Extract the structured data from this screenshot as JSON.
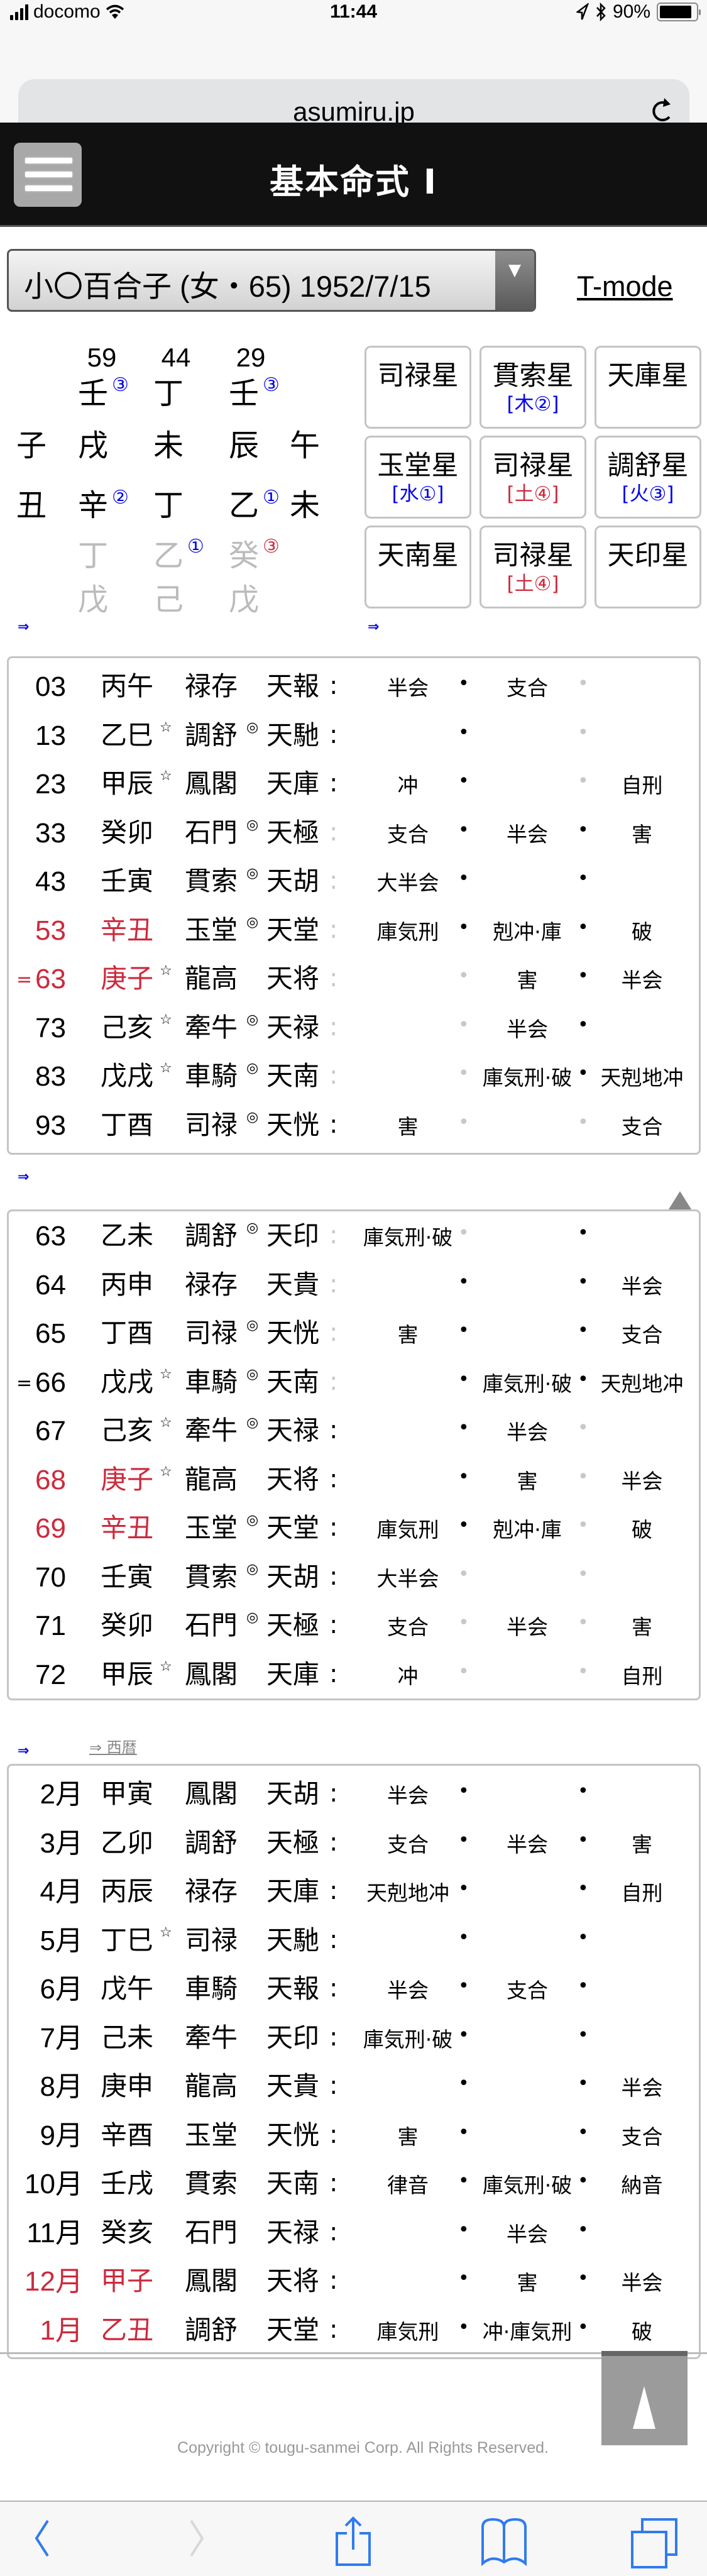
{
  "statusbar": {
    "carrier": "docomo",
    "time": "11:44",
    "battery": "90%",
    "battery_level": 0.9
  },
  "browser": {
    "url": "asumiru.jp"
  },
  "header": {
    "title": "基本命式 Ⅰ"
  },
  "selector": {
    "value": "小〇百合子 (女・65) 1952/7/15",
    "arrow": "▼"
  },
  "tmode_link": "T-mode",
  "meishiki": {
    "ages": [
      "59",
      "44",
      "29"
    ],
    "heavenly_stems": [
      "壬",
      "丁",
      "壬"
    ],
    "stem_marks": [
      "③",
      "",
      "③"
    ],
    "earthly_branches": [
      "戌",
      "未",
      "辰"
    ],
    "side_branches_top": [
      "子",
      "午"
    ],
    "side_branches_bottom": [
      "丑",
      "未"
    ],
    "hidden_main": [
      "辛",
      "丁",
      "乙"
    ],
    "hidden_main_marks": [
      "②",
      "",
      "①"
    ],
    "hidden_mid": [
      "丁",
      "乙",
      "癸"
    ],
    "hidden_mid_marks": [
      "",
      "①",
      "③"
    ],
    "hidden_low": [
      "戊",
      "己",
      "戊"
    ]
  },
  "star_grid": [
    {
      "name": "司禄星",
      "element": ""
    },
    {
      "name": "貫索星",
      "element": "[木②]",
      "element_color": "blue"
    },
    {
      "name": "天庫星",
      "element": ""
    },
    {
      "name": "玉堂星",
      "element": "[水①]",
      "element_color": "blue"
    },
    {
      "name": "司禄星",
      "element": "[土④]",
      "element_color": "red"
    },
    {
      "name": "調舒星",
      "element": "[火③]",
      "element_color": "blue"
    },
    {
      "name": "天南星",
      "element": ""
    },
    {
      "name": "司禄星",
      "element": "[土④]",
      "element_color": "red"
    },
    {
      "name": "天印星",
      "element": ""
    }
  ],
  "arrows": {
    "symbol": "⇒",
    "seireki_link": "⇒ 西暦"
  },
  "colors": {
    "link_blue": "#0000ee",
    "highlight_red": "#cc2a3c",
    "light_gray": "#c8c8c8",
    "header_black": "#111111"
  },
  "taiun_table": [
    {
      "mark": "",
      "num": "03",
      "kanshi": "丙午",
      "s1": "",
      "star": "禄存",
      "s2": "",
      "ten": "天報",
      "colon": "dark",
      "r1": "半会",
      "d1": "dark",
      "r2": "支合",
      "d2": "light",
      "r3": "",
      "red": false
    },
    {
      "mark": "",
      "num": "13",
      "kanshi": "乙巳",
      "s1": "☆",
      "star": "調舒",
      "s2": "◎",
      "ten": "天馳",
      "colon": "dark",
      "r1": "",
      "d1": "dark",
      "r2": "",
      "d2": "light",
      "r3": "",
      "red": false
    },
    {
      "mark": "",
      "num": "23",
      "kanshi": "甲辰",
      "s1": "☆",
      "star": "鳳閣",
      "s2": "",
      "ten": "天庫",
      "colon": "dark",
      "r1": "冲",
      "d1": "dark",
      "r2": "",
      "d2": "light",
      "r3": "自刑",
      "red": false
    },
    {
      "mark": "",
      "num": "33",
      "kanshi": "癸卯",
      "s1": "",
      "star": "石門",
      "s2": "◎",
      "ten": "天極",
      "colon": "light",
      "r1": "支合",
      "d1": "dark",
      "r2": "半会",
      "d2": "dark",
      "r3": "害",
      "red": false
    },
    {
      "mark": "",
      "num": "43",
      "kanshi": "壬寅",
      "s1": "",
      "star": "貫索",
      "s2": "◎",
      "ten": "天胡",
      "colon": "light",
      "r1": "大半会",
      "d1": "dark",
      "r2": "",
      "d2": "dark",
      "r3": "",
      "red": false
    },
    {
      "mark": "",
      "num": "53",
      "kanshi": "辛丑",
      "s1": "",
      "star": "玉堂",
      "s2": "◎",
      "ten": "天堂",
      "colon": "light",
      "r1": "庫気刑",
      "d1": "dark",
      "r2": "剋冲·庫",
      "d2": "dark",
      "r3": "破",
      "red": true
    },
    {
      "mark": "=",
      "num": "63",
      "kanshi": "庚子",
      "s1": "☆",
      "star": "龍高",
      "s2": "",
      "ten": "天将",
      "colon": "light",
      "r1": "",
      "d1": "light",
      "r2": "害",
      "d2": "dark",
      "r3": "半会",
      "red": true
    },
    {
      "mark": "",
      "num": "73",
      "kanshi": "己亥",
      "s1": "☆",
      "star": "牽牛",
      "s2": "◎",
      "ten": "天禄",
      "colon": "light",
      "r1": "",
      "d1": "light",
      "r2": "半会",
      "d2": "dark",
      "r3": "",
      "red": false
    },
    {
      "mark": "",
      "num": "83",
      "kanshi": "戊戌",
      "s1": "☆",
      "star": "車騎",
      "s2": "◎",
      "ten": "天南",
      "colon": "light",
      "r1": "",
      "d1": "light",
      "r2": "庫気刑·破",
      "d2": "dark",
      "r3": "天剋地冲",
      "red": false
    },
    {
      "mark": "",
      "num": "93",
      "kanshi": "丁酉",
      "s1": "",
      "star": "司禄",
      "s2": "◎",
      "ten": "天恍",
      "colon": "dark",
      "r1": "害",
      "d1": "light",
      "r2": "",
      "d2": "light",
      "r3": "支合",
      "red": false
    }
  ],
  "nenun_table": [
    {
      "mark": "",
      "num": "63",
      "kanshi": "乙未",
      "s1": "",
      "star": "調舒",
      "s2": "◎",
      "ten": "天印",
      "colon": "light",
      "r1": "庫気刑·破",
      "d1": "light",
      "r2": "",
      "d2": "dark",
      "r3": "",
      "red": false
    },
    {
      "mark": "",
      "num": "64",
      "kanshi": "丙申",
      "s1": "",
      "star": "禄存",
      "s2": "",
      "ten": "天貴",
      "colon": "light",
      "r1": "",
      "d1": "dark",
      "r2": "",
      "d2": "dark",
      "r3": "半会",
      "red": false
    },
    {
      "mark": "",
      "num": "65",
      "kanshi": "丁酉",
      "s1": "",
      "star": "司禄",
      "s2": "◎",
      "ten": "天恍",
      "colon": "light",
      "r1": "害",
      "d1": "dark",
      "r2": "",
      "d2": "dark",
      "r3": "支合",
      "red": false
    },
    {
      "mark": "=",
      "num": "66",
      "kanshi": "戊戌",
      "s1": "☆",
      "star": "車騎",
      "s2": "◎",
      "ten": "天南",
      "colon": "light",
      "r1": "",
      "d1": "dark",
      "r2": "庫気刑·破",
      "d2": "dark",
      "r3": "天剋地冲",
      "red": false
    },
    {
      "mark": "",
      "num": "67",
      "kanshi": "己亥",
      "s1": "☆",
      "star": "牽牛",
      "s2": "◎",
      "ten": "天禄",
      "colon": "dark",
      "r1": "",
      "d1": "dark",
      "r2": "半会",
      "d2": "light",
      "r3": "",
      "red": false
    },
    {
      "mark": "",
      "num": "68",
      "kanshi": "庚子",
      "s1": "☆",
      "star": "龍高",
      "s2": "",
      "ten": "天将",
      "colon": "dark",
      "r1": "",
      "d1": "dark",
      "r2": "害",
      "d2": "light",
      "r3": "半会",
      "red": true
    },
    {
      "mark": "",
      "num": "69",
      "kanshi": "辛丑",
      "s1": "",
      "star": "玉堂",
      "s2": "◎",
      "ten": "天堂",
      "colon": "dark",
      "r1": "庫気刑",
      "d1": "dark",
      "r2": "剋冲·庫",
      "d2": "light",
      "r3": "破",
      "red": true
    },
    {
      "mark": "",
      "num": "70",
      "kanshi": "壬寅",
      "s1": "",
      "star": "貫索",
      "s2": "◎",
      "ten": "天胡",
      "colon": "dark",
      "r1": "大半会",
      "d1": "light",
      "r2": "",
      "d2": "light",
      "r3": "",
      "red": false
    },
    {
      "mark": "",
      "num": "71",
      "kanshi": "癸卯",
      "s1": "",
      "star": "石門",
      "s2": "◎",
      "ten": "天極",
      "colon": "dark",
      "r1": "支合",
      "d1": "light",
      "r2": "半会",
      "d2": "light",
      "r3": "害",
      "red": false
    },
    {
      "mark": "",
      "num": "72",
      "kanshi": "甲辰",
      "s1": "☆",
      "star": "鳳閣",
      "s2": "",
      "ten": "天庫",
      "colon": "dark",
      "r1": "冲",
      "d1": "light",
      "r2": "",
      "d2": "light",
      "r3": "自刑",
      "red": false
    }
  ],
  "getsuun_table": [
    {
      "mark": "",
      "num": "2月",
      "kanshi": "甲寅",
      "s1": "",
      "star": "鳳閣",
      "s2": "",
      "ten": "天胡",
      "colon": "dark",
      "r1": "半会",
      "d1": "dark",
      "r2": "",
      "d2": "dark",
      "r3": "",
      "red": false
    },
    {
      "mark": "",
      "num": "3月",
      "kanshi": "乙卯",
      "s1": "",
      "star": "調舒",
      "s2": "",
      "ten": "天極",
      "colon": "dark",
      "r1": "支合",
      "d1": "dark",
      "r2": "半会",
      "d2": "dark",
      "r3": "害",
      "red": false
    },
    {
      "mark": "",
      "num": "4月",
      "kanshi": "丙辰",
      "s1": "",
      "star": "禄存",
      "s2": "",
      "ten": "天庫",
      "colon": "dark",
      "r1": "天剋地冲",
      "d1": "dark",
      "r2": "",
      "d2": "dark",
      "r3": "自刑",
      "red": false
    },
    {
      "mark": "",
      "num": "5月",
      "kanshi": "丁巳",
      "s1": "☆",
      "star": "司禄",
      "s2": "",
      "ten": "天馳",
      "colon": "dark",
      "r1": "",
      "d1": "dark",
      "r2": "",
      "d2": "dark",
      "r3": "",
      "red": false
    },
    {
      "mark": "",
      "num": "6月",
      "kanshi": "戊午",
      "s1": "",
      "star": "車騎",
      "s2": "",
      "ten": "天報",
      "colon": "dark",
      "r1": "半会",
      "d1": "dark",
      "r2": "支合",
      "d2": "dark",
      "r3": "",
      "red": false
    },
    {
      "mark": "",
      "num": "7月",
      "kanshi": "己未",
      "s1": "",
      "star": "牽牛",
      "s2": "",
      "ten": "天印",
      "colon": "dark",
      "r1": "庫気刑·破",
      "d1": "dark",
      "r2": "",
      "d2": "dark",
      "r3": "",
      "red": false
    },
    {
      "mark": "",
      "num": "8月",
      "kanshi": "庚申",
      "s1": "",
      "star": "龍高",
      "s2": "",
      "ten": "天貴",
      "colon": "dark",
      "r1": "",
      "d1": "dark",
      "r2": "",
      "d2": "dark",
      "r3": "半会",
      "red": false
    },
    {
      "mark": "",
      "num": "9月",
      "kanshi": "辛酉",
      "s1": "",
      "star": "玉堂",
      "s2": "",
      "ten": "天恍",
      "colon": "dark",
      "r1": "害",
      "d1": "dark",
      "r2": "",
      "d2": "dark",
      "r3": "支合",
      "red": false
    },
    {
      "mark": "",
      "num": "10月",
      "kanshi": "壬戌",
      "s1": "",
      "star": "貫索",
      "s2": "",
      "ten": "天南",
      "colon": "dark",
      "r1": "律音",
      "d1": "dark",
      "r2": "庫気刑·破",
      "d2": "dark",
      "r3": "納音",
      "red": false
    },
    {
      "mark": "",
      "num": "11月",
      "kanshi": "癸亥",
      "s1": "",
      "star": "石門",
      "s2": "",
      "ten": "天禄",
      "colon": "dark",
      "r1": "",
      "d1": "dark",
      "r2": "半会",
      "d2": "dark",
      "r3": "",
      "red": false
    },
    {
      "mark": "",
      "num": "12月",
      "kanshi": "甲子",
      "s1": "",
      "star": "鳳閣",
      "s2": "",
      "ten": "天将",
      "colon": "dark",
      "r1": "",
      "d1": "dark",
      "r2": "害",
      "d2": "dark",
      "r3": "半会",
      "red": true
    },
    {
      "mark": "",
      "num": "1月",
      "kanshi": "乙丑",
      "s1": "",
      "star": "調舒",
      "s2": "",
      "ten": "天堂",
      "colon": "dark",
      "r1": "庫気刑",
      "d1": "dark",
      "r2": "冲·庫気刑",
      "d2": "dark",
      "r3": "破",
      "red": true
    }
  ],
  "footer": {
    "copyright": "Copyright © tougu-sanmei Corp. All Rights Reserved.",
    "to_top": "▲"
  },
  "toolbar": {
    "items": [
      "back",
      "forward",
      "share",
      "bookmarks",
      "tabs"
    ]
  }
}
